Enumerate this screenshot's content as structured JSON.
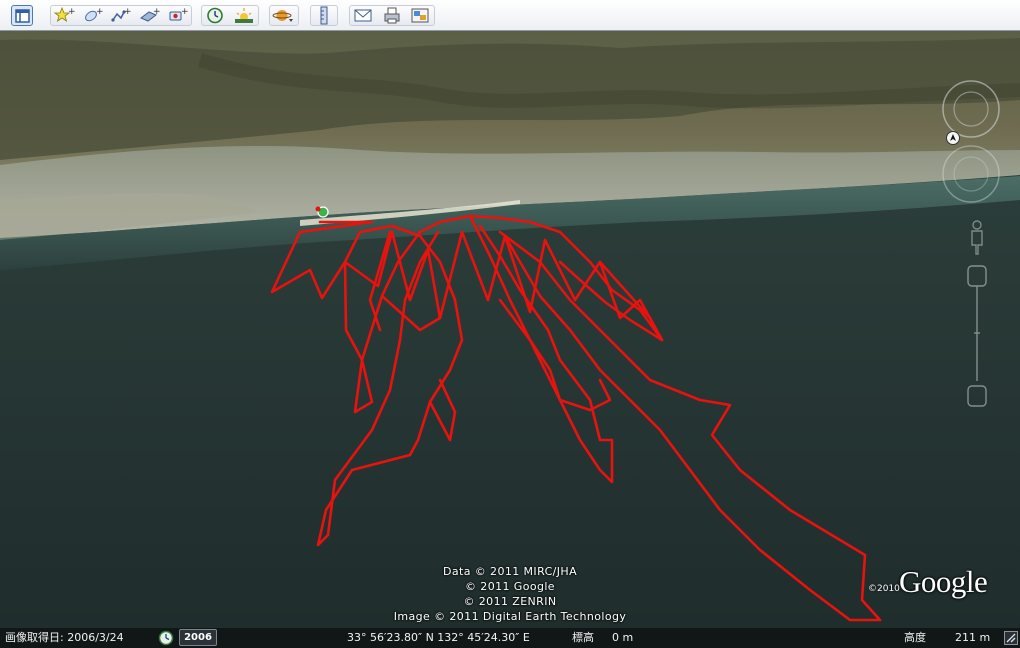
{
  "toolbar": {
    "buttons": [
      {
        "id": "sidebar-toggle",
        "icon": "sidebar-icon"
      },
      {
        "id": "add-placemark",
        "icon": "placemark-pin-icon"
      },
      {
        "id": "add-polygon",
        "icon": "polygon-icon"
      },
      {
        "id": "add-path",
        "icon": "path-icon"
      },
      {
        "id": "add-image-overlay",
        "icon": "image-overlay-icon"
      },
      {
        "id": "record-tour",
        "icon": "record-tour-icon"
      },
      {
        "id": "historical-imagery",
        "icon": "clock-icon"
      },
      {
        "id": "sunlight",
        "icon": "sun-icon"
      },
      {
        "id": "switch-planet",
        "icon": "planet-icon"
      },
      {
        "id": "ruler",
        "icon": "ruler-icon"
      },
      {
        "id": "email",
        "icon": "envelope-icon"
      },
      {
        "id": "print",
        "icon": "printer-icon"
      },
      {
        "id": "save-image",
        "icon": "save-image-icon"
      }
    ]
  },
  "attribution": {
    "line1": "Data © 2011 MIRC/JHA",
    "line2": "© 2011 Google",
    "line3": "© 2011 ZENRIN",
    "line4": "Image © 2011 Digital Earth Technology"
  },
  "logo": {
    "year": "©2010",
    "text": "Google"
  },
  "status": {
    "imagery_date": "画像取得日: 2006/3/24",
    "timeline_year": "2006",
    "coordinates": "33° 56′23.80″ N 132° 45′24.30″ E",
    "elev_label": "標高",
    "elev_value": "0 m",
    "eye_alt_label": "高度",
    "eye_alt_value": "211 m"
  },
  "colors": {
    "track": "#e8120f",
    "sea": "#23332f",
    "toolbar_bg": "#f2f4f7",
    "statusbar_bg": "#111617"
  }
}
